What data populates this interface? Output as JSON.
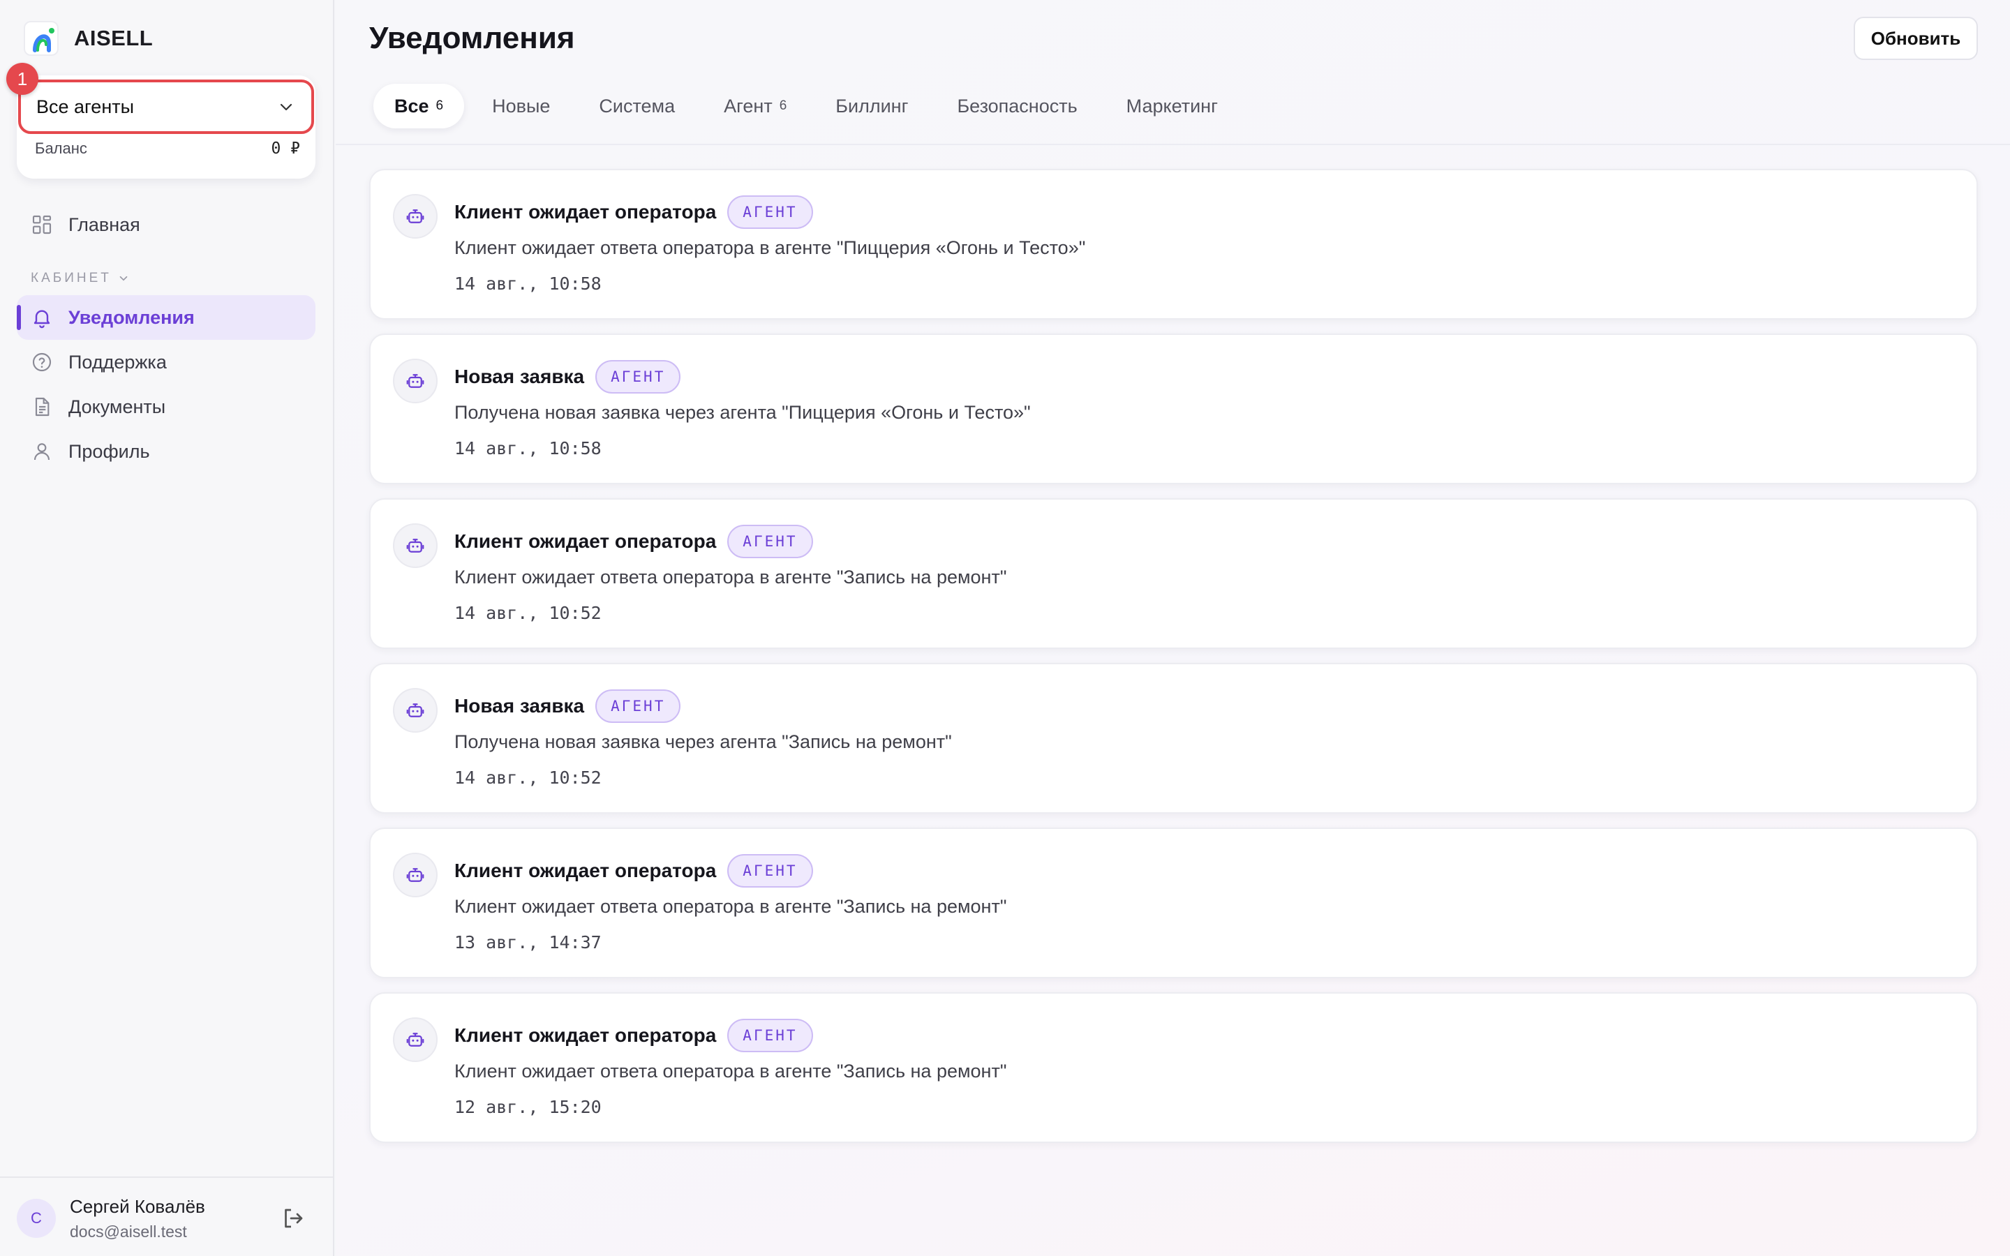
{
  "brand": {
    "name": "AISELL"
  },
  "agent_selector": {
    "value": "Все агенты",
    "step_badge": "1"
  },
  "balance": {
    "label": "Баланс",
    "value": "0 ₽"
  },
  "nav": {
    "home": "Главная",
    "section": "КАБИНЕТ",
    "notifications": "Уведомления",
    "support": "Поддержка",
    "documents": "Документы",
    "profile": "Профиль"
  },
  "user": {
    "initial": "С",
    "name": "Сергей Ковалёв",
    "email": "docs@aisell.test"
  },
  "header": {
    "title": "Уведомления",
    "refresh_label": "Обновить"
  },
  "tabs": [
    {
      "label": "Все",
      "count": "6"
    },
    {
      "label": "Новые",
      "count": ""
    },
    {
      "label": "Система",
      "count": ""
    },
    {
      "label": "Агент",
      "count": "6"
    },
    {
      "label": "Биллинг",
      "count": ""
    },
    {
      "label": "Безопасность",
      "count": ""
    },
    {
      "label": "Маркетинг",
      "count": ""
    }
  ],
  "notifications": [
    {
      "title": "Клиент ожидает оператора",
      "tag": "АГЕНТ",
      "text": "Клиент ожидает ответа оператора в агенте \"Пиццерия «Огонь и Тесто»\"",
      "time": "14 авг., 10:58"
    },
    {
      "title": "Новая заявка",
      "tag": "АГЕНТ",
      "text": "Получена новая заявка через агента \"Пиццерия «Огонь и Тесто»\"",
      "time": "14 авг., 10:58"
    },
    {
      "title": "Клиент ожидает оператора",
      "tag": "АГЕНТ",
      "text": "Клиент ожидает ответа оператора в агенте \"Запись на ремонт\"",
      "time": "14 авг., 10:52"
    },
    {
      "title": "Новая заявка",
      "tag": "АГЕНТ",
      "text": "Получена новая заявка через агента \"Запись на ремонт\"",
      "time": "14 авг., 10:52"
    },
    {
      "title": "Клиент ожидает оператора",
      "tag": "АГЕНТ",
      "text": "Клиент ожидает ответа оператора в агенте \"Запись на ремонт\"",
      "time": "13 авг., 14:37"
    },
    {
      "title": "Клиент ожидает оператора",
      "tag": "АГЕНТ",
      "text": "Клиент ожидает ответа оператора в агенте \"Запись на ремонт\"",
      "time": "12 авг., 15:20"
    }
  ],
  "colors": {
    "accent": "#6b3fd6",
    "highlight": "#e5484d",
    "active_bg": "#ece7fb"
  }
}
